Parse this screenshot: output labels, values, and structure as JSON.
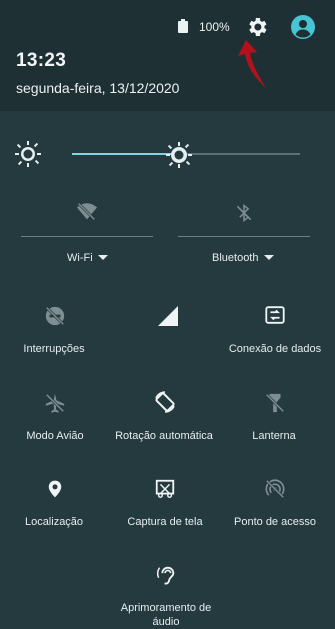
{
  "status_bar": {
    "battery_percent": "100%"
  },
  "header": {
    "time": "13:23",
    "date": "segunda-feira, 13/12/2020"
  },
  "brightness": {
    "level": 0.47
  },
  "quick_settings": {
    "wifi": "Wi-Fi",
    "bluetooth": "Bluetooth",
    "tiles": [
      "Interrupções",
      "",
      "Conexão de dados",
      "Modo Avião",
      "Rotação automática",
      "Lanterna",
      "Localização",
      "Captura de tela",
      "Ponto de acesso",
      "Aprimoramento de áudio"
    ]
  },
  "colors": {
    "background": "#243a3f",
    "header_bg": "#1f3035",
    "accent": "#7fd6df",
    "arrow_annotation": "#b3121c"
  }
}
